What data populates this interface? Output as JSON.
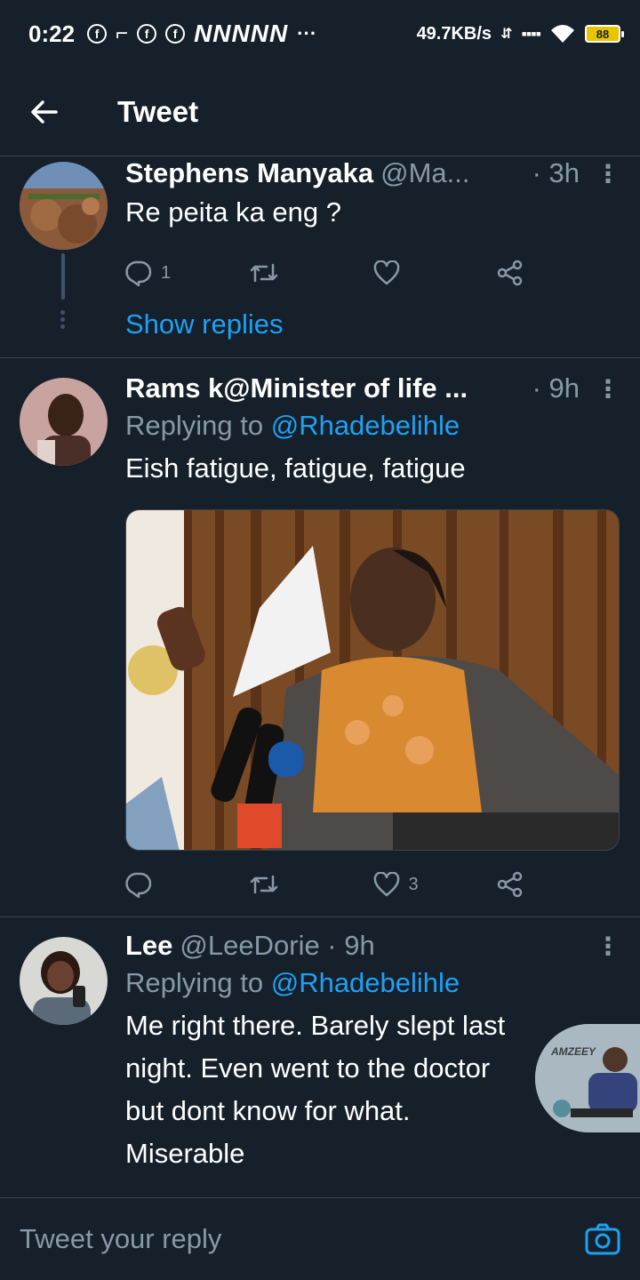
{
  "statusbar": {
    "time": "0:22",
    "app_icons": [
      "ⓕ",
      "⌐",
      "ⓕ",
      "ⓕ"
    ],
    "signal_text": "NNNNN",
    "speed": "49.7KB/s",
    "battery": "88"
  },
  "header": {
    "title": "Tweet"
  },
  "tweets": [
    {
      "name": "Stephens Manyaka",
      "handle": "@Ma...",
      "time": "· 3h",
      "text": "Re peita ka eng ?",
      "reply_count": "1",
      "like_count": "",
      "show_replies": "Show replies"
    },
    {
      "name": "Rams k@Minister of life ...",
      "handle": "",
      "time": "· 9h",
      "replying_label": "Replying to",
      "replying_to": "@Rhadebelihle",
      "text": "Eish fatigue, fatigue, fatigue",
      "reply_count": "",
      "like_count": "3"
    },
    {
      "name": "Lee",
      "handle": "@LeeDorie · 9h",
      "time": "",
      "replying_label": "Replying to",
      "replying_to": "@Rhadebelihle",
      "text_lines": [
        "Me right there. Barely slept  last",
        "night.  Even  went to the doctor",
        "but  dont know  for what.",
        "Miserable"
      ]
    }
  ],
  "bubble_label": "AMZEEY",
  "reply_bar": {
    "placeholder": "Tweet your reply"
  },
  "colors": {
    "background": "#15202b",
    "accent": "#1da1f2",
    "muted": "#8899a6",
    "divider": "#38444d"
  }
}
